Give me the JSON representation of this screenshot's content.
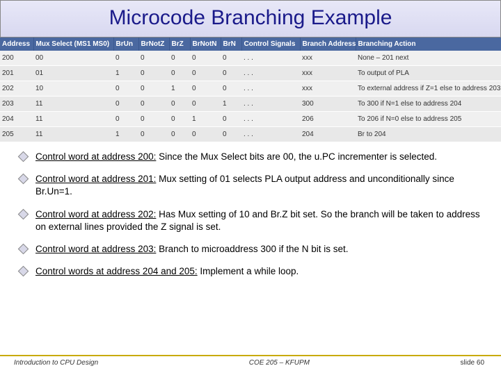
{
  "title": "Microcode Branching Example",
  "table": {
    "headers": [
      "Address",
      "Mux Select (MS1 MS0)",
      "BrUn",
      "BrNotZ",
      "BrZ",
      "BrNotN",
      "BrN",
      "Control Signals",
      "Branch Address",
      "Branching Action"
    ],
    "rows": [
      [
        "200",
        "00",
        "0",
        "0",
        "0",
        "0",
        "0",
        ". . .",
        "xxx",
        "None – 201 next"
      ],
      [
        "201",
        "01",
        "1",
        "0",
        "0",
        "0",
        "0",
        ". . .",
        "xxx",
        "To output of PLA"
      ],
      [
        "202",
        "10",
        "0",
        "0",
        "1",
        "0",
        "0",
        ". . .",
        "xxx",
        "To external address if Z=1 else to address 203"
      ],
      [
        "203",
        "11",
        "0",
        "0",
        "0",
        "0",
        "1",
        ". . .",
        "300",
        "To 300 if N=1 else to address 204"
      ],
      [
        "204",
        "11",
        "0",
        "0",
        "0",
        "1",
        "0",
        ". . .",
        "206",
        "To 206 if N=0 else to address 205"
      ],
      [
        "205",
        "11",
        "1",
        "0",
        "0",
        "0",
        "0",
        ". . .",
        "204",
        "Br to 204"
      ]
    ]
  },
  "bullets": [
    {
      "lead": "Control word at address 200:",
      "rest": " Since the Mux Select bits are 00, the u.PC incrementer is selected."
    },
    {
      "lead": "Control word at address 201:",
      "rest": " Mux setting of 01 selects PLA output address and unconditionally since Br.Un=1."
    },
    {
      "lead": "Control word at address 202:",
      "rest": " Has Mux setting of 10 and Br.Z bit set. So the branch will be taken to address on external lines provided the Z signal is set."
    },
    {
      "lead": "Control word at address 203:",
      "rest": " Branch to microaddress 300 if the N bit is set."
    },
    {
      "lead": "Control words at address 204 and 205:",
      "rest": " Implement a while loop."
    }
  ],
  "footer": {
    "left": "Introduction to CPU Design",
    "center": "COE 205 – KFUPM",
    "right": "slide 60"
  },
  "colwidths": [
    "48",
    "115",
    "36",
    "44",
    "30",
    "44",
    "30",
    "84",
    "80",
    "209"
  ]
}
